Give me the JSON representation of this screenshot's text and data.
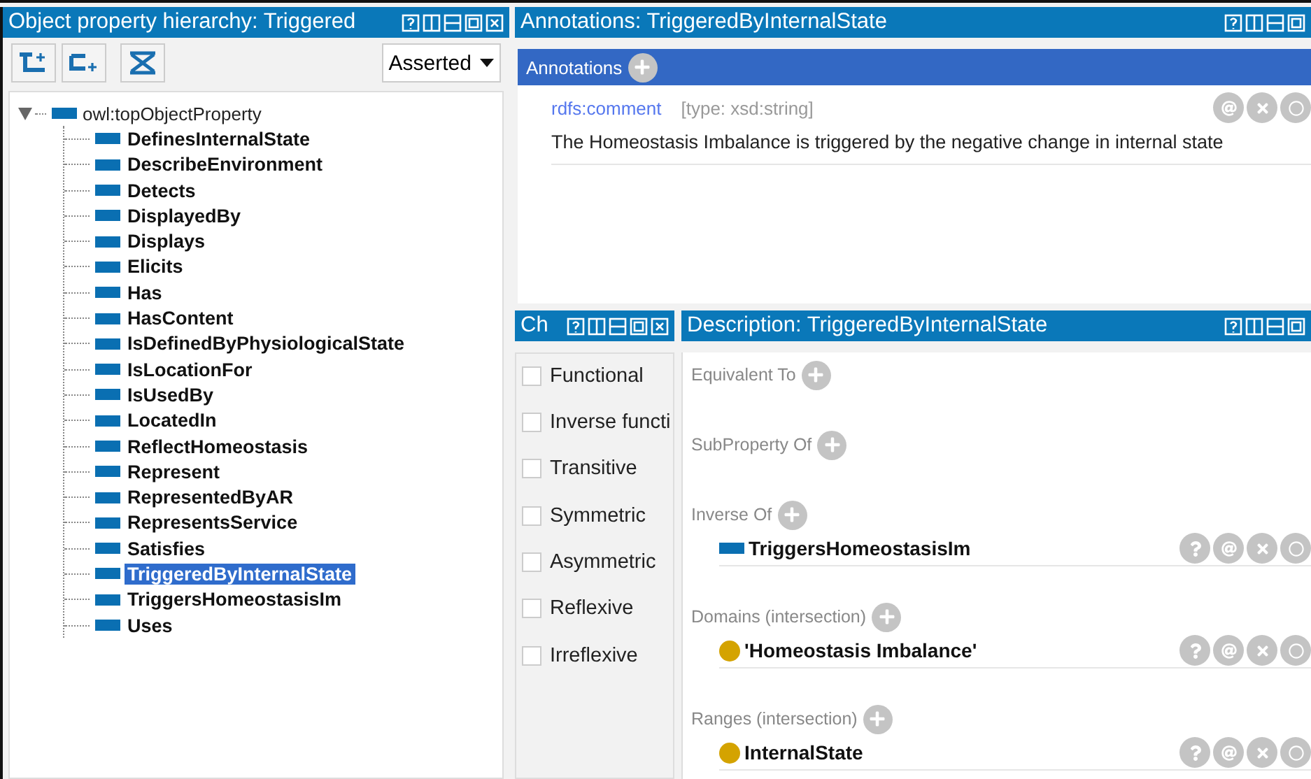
{
  "hierarchy": {
    "title": "Object property hierarchy: Triggered",
    "view_select": "Asserted",
    "tree": {
      "label": "owl:topObjectProperty",
      "expanded": true,
      "children": [
        {
          "label": "DefinesInternalState",
          "selected": false
        },
        {
          "label": "DescribeEnvironment",
          "selected": false
        },
        {
          "label": "Detects",
          "selected": false
        },
        {
          "label": "DisplayedBy",
          "selected": false
        },
        {
          "label": "Displays",
          "selected": false
        },
        {
          "label": "Elicits",
          "selected": false
        },
        {
          "label": "Has",
          "selected": false
        },
        {
          "label": "HasContent",
          "selected": false
        },
        {
          "label": "IsDefinedByPhysiologicalState",
          "selected": false
        },
        {
          "label": "IsLocationFor",
          "selected": false
        },
        {
          "label": "IsUsedBy",
          "selected": false
        },
        {
          "label": "LocatedIn",
          "selected": false
        },
        {
          "label": "ReflectHomeostasis",
          "selected": false
        },
        {
          "label": "Represent",
          "selected": false
        },
        {
          "label": "RepresentedByAR",
          "selected": false
        },
        {
          "label": "RepresentsService",
          "selected": false
        },
        {
          "label": "Satisfies",
          "selected": false
        },
        {
          "label": "TriggeredByInternalState",
          "selected": true
        },
        {
          "label": "TriggersHomeostasisIm",
          "selected": false
        },
        {
          "label": "Uses",
          "selected": false
        }
      ]
    }
  },
  "annotations_panel": {
    "title": "Annotations: TriggeredByInternalState",
    "header": "Annotations",
    "items": [
      {
        "property": "rdfs:comment",
        "type": "[type: xsd:string]",
        "value": "The Homeostasis Imbalance is triggered by the negative change in internal state"
      }
    ]
  },
  "characteristics": {
    "title": "Ch",
    "items": [
      {
        "label": "Functional",
        "checked": false
      },
      {
        "label": "Inverse functi",
        "checked": false
      },
      {
        "label": "Transitive",
        "checked": false
      },
      {
        "label": "Symmetric",
        "checked": false
      },
      {
        "label": "Asymmetric",
        "checked": false
      },
      {
        "label": "Reflexive",
        "checked": false
      },
      {
        "label": "Irreflexive",
        "checked": false
      }
    ]
  },
  "description": {
    "title": "Description: TriggeredByInternalState",
    "sections": [
      {
        "label": "Equivalent To"
      },
      {
        "label": "SubProperty Of"
      },
      {
        "label": "Inverse Of",
        "items": [
          {
            "kind": "property",
            "label": "TriggersHomeostasisIm"
          }
        ]
      },
      {
        "label": "Domains (intersection)",
        "items": [
          {
            "kind": "class",
            "label": "'Homeostasis Imbalance'"
          }
        ]
      },
      {
        "label": "Ranges (intersection)",
        "items": [
          {
            "kind": "class",
            "label": "InternalState"
          }
        ]
      }
    ]
  }
}
